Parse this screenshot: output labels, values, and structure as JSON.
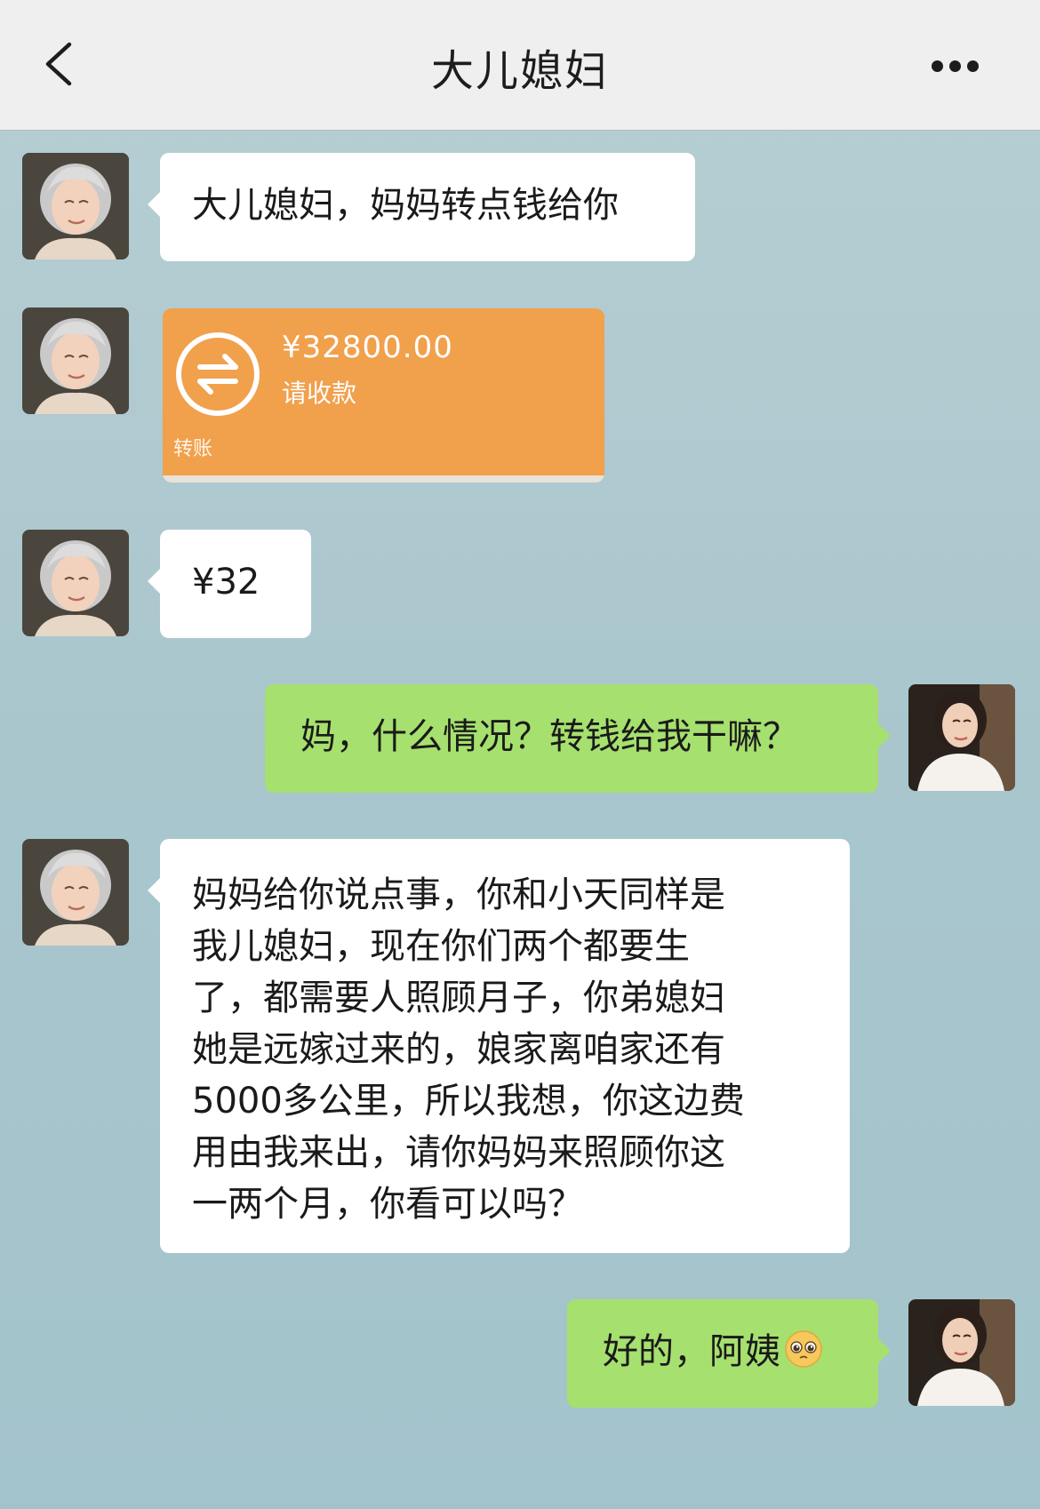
{
  "header": {
    "title": "大儿媳妇",
    "back_icon": "chevron-left-icon",
    "more_icon": "more-dots-icon"
  },
  "messages": [
    {
      "side": "left",
      "type": "text",
      "text": "大儿媳妇，妈妈转点钱给你"
    },
    {
      "side": "left",
      "type": "transfer",
      "amount": "¥32800.00",
      "status": "请收款",
      "label": "转账"
    },
    {
      "side": "left",
      "type": "text",
      "text": "¥32"
    },
    {
      "side": "right",
      "type": "text",
      "text": "妈，什么情况？转钱给我干嘛？"
    },
    {
      "side": "left",
      "type": "text",
      "lines": [
        "妈妈给你说点事，你和小天同样是",
        "我儿媳妇，现在你们两个都要生",
        "了，都需要人照顾月子，你弟媳妇",
        "她是远嫁过来的，娘家离咱家还有",
        "5000多公里，所以我想，你这边费",
        "用由我来出，请你妈妈来照顾你这",
        "一两个月，你看可以吗？"
      ]
    },
    {
      "side": "right",
      "type": "text",
      "text": "好的，阿姨",
      "emoji": "pleading-face-icon"
    }
  ],
  "colors": {
    "background": "#aac6cd",
    "nav_bg": "#efefef",
    "left_bubble": "#ffffff",
    "right_bubble": "#a6e06e",
    "transfer": "#f1a04c"
  }
}
